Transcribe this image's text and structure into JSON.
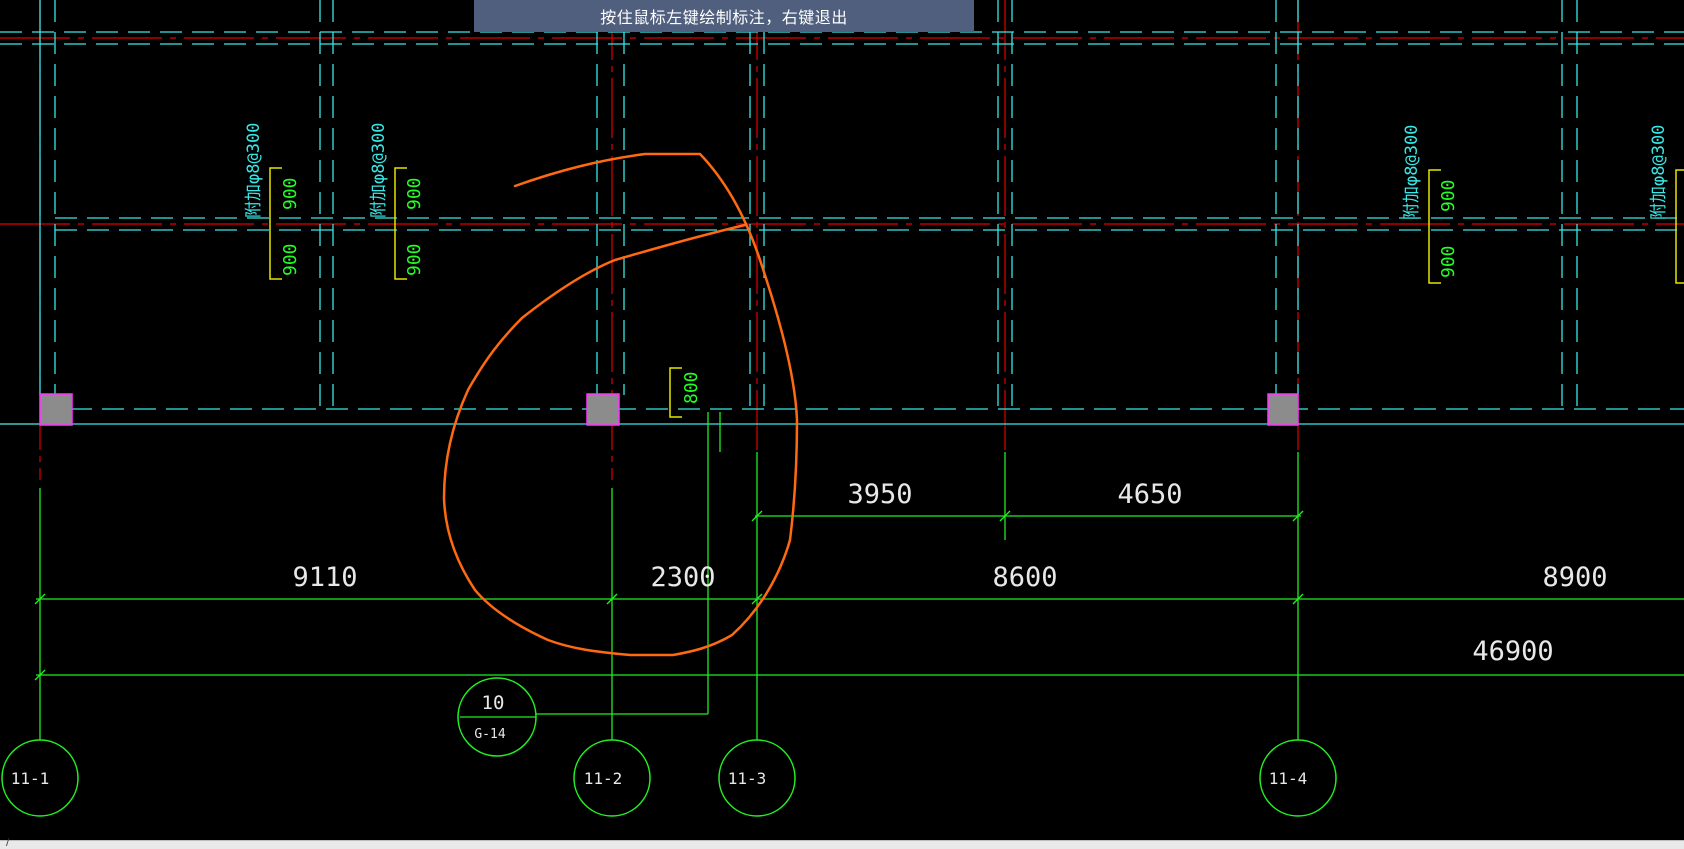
{
  "banner": {
    "hint": "按住鼠标左键绘制标注，右键退出"
  },
  "colors": {
    "background": "#000000",
    "grid_red": "#e00000",
    "beam_cyan": "#38e8e8",
    "dimension_green": "#22ee22",
    "column_fill": "#8c8c8c",
    "column_edge": "#ff33ff",
    "annotation_orange": "#ff6a10",
    "bracket_yellow": "#e6e600"
  },
  "dimensions": {
    "upper_row": [
      "3950",
      "4650"
    ],
    "middle_row": [
      "9110",
      "2300",
      "8600",
      "8900"
    ],
    "total": "46900"
  },
  "axis_bubbles": [
    "11-1",
    "11-2",
    "11-3",
    "11-4"
  ],
  "detail_marker": {
    "number": "10",
    "sheet": "G-14"
  },
  "rebar_labels": {
    "stirrup": "附加φ8@300",
    "len_900": "900",
    "len_800": "800"
  }
}
